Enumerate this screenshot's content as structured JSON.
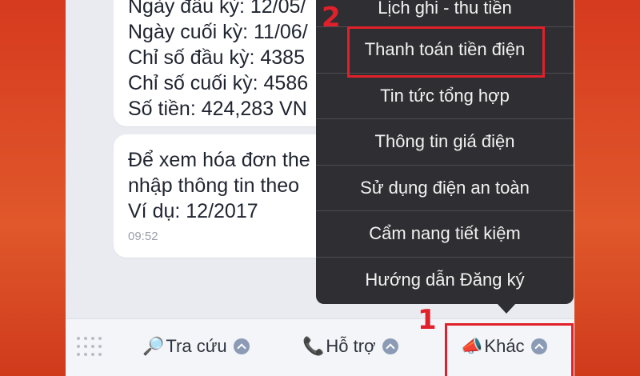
{
  "chat": {
    "bubble1": {
      "lines": [
        "Ngày đầu kỳ: 12/05/",
        "Ngày cuối kỳ: 11/06/",
        "Chỉ số đầu kỳ: 4385",
        "Chỉ số cuối kỳ: 4586",
        "Số tiền: 424,283 VN"
      ]
    },
    "bubble2": {
      "lines": [
        "Để xem hóa đơn the",
        "nhập thông tin theo",
        "Ví dụ: 12/2017"
      ],
      "time": "09:52"
    }
  },
  "menu": {
    "items": [
      "Lịch ghi - thu tiền",
      "Thanh toán tiền điện",
      "Tin tức tổng hợp",
      "Thông tin giá điện",
      "Sử dụng điện an toàn",
      "Cẩm nang tiết kiệm",
      "Hướng dẫn Đăng ký"
    ]
  },
  "tabbar": {
    "tra_cuu": {
      "icon": "🔎",
      "label": "Tra cứu"
    },
    "ho_tro": {
      "icon": "📞",
      "label": "Hỗ trợ"
    },
    "khac": {
      "icon": "📣",
      "label": "Khác"
    }
  },
  "annotations": {
    "step1": "1",
    "step2": "2"
  },
  "colors": {
    "highlight": "#e0202a",
    "menu_bg": "#2f2f33",
    "chat_bg": "#e9ebf0"
  }
}
